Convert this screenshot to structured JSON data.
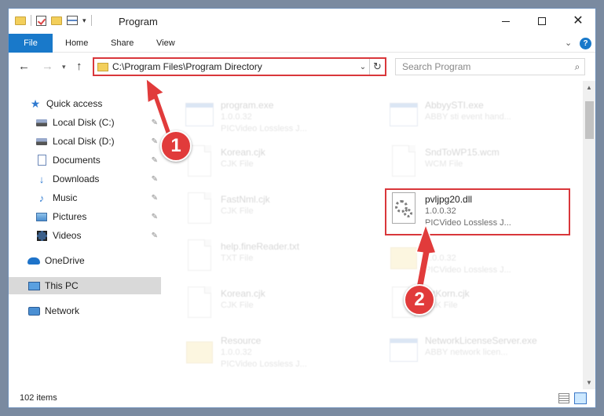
{
  "window": {
    "title": "Program"
  },
  "ribbon": {
    "tabs": [
      "File",
      "Home",
      "Share",
      "View"
    ]
  },
  "address": {
    "path": "C:\\Program Files\\Program Directory"
  },
  "search": {
    "placeholder": "Search Program"
  },
  "nav": {
    "items": [
      {
        "label": "Quick access"
      },
      {
        "label": "Local Disk (C:)"
      },
      {
        "label": "Local Disk (D:)"
      },
      {
        "label": "Documents"
      },
      {
        "label": "Downloads"
      },
      {
        "label": "Music"
      },
      {
        "label": "Pictures"
      },
      {
        "label": "Videos"
      },
      {
        "label": "OneDrive"
      },
      {
        "label": "This PC"
      },
      {
        "label": "Network"
      }
    ]
  },
  "files": [
    {
      "name": "program.exe",
      "line1": "1.0.0.32",
      "line2": "PICVideo Lossless J...",
      "icon": "exe-icon"
    },
    {
      "name": "AbbyySTI.exe",
      "line1": "ABBY sti event hand...",
      "line2": "",
      "icon": "exe-icon"
    },
    {
      "name": "Korean.cjk",
      "line1": "CJK File",
      "line2": "",
      "icon": "blank-file-icon"
    },
    {
      "name": "SndToWP15.wcm",
      "line1": "WCM File",
      "line2": "",
      "icon": "blank-file-icon"
    },
    {
      "name": "FastNml.cjk",
      "line1": "CJK File",
      "line2": "",
      "icon": "blank-file-icon"
    },
    {
      "name": "pvljpg20.dll",
      "line1": "1.0.0.32",
      "line2": "PICVideo Lossless J...",
      "icon": "dll-gear-icon"
    },
    {
      "name": "help.fineReader.txt",
      "line1": "TXT File",
      "line2": "",
      "icon": "blank-file-icon"
    },
    {
      "name": "...",
      "line1": "1.0.0.32",
      "line2": "PICVideo Lossless J...",
      "icon": "folder-icon"
    },
    {
      "name": "Korean.cjk",
      "line1": "CJK File",
      "line2": "",
      "icon": "blank-file-icon"
    },
    {
      "name": "...tKorn.cjk",
      "line1": "CJK File",
      "line2": "",
      "icon": "blank-file-icon"
    },
    {
      "name": "Resource",
      "line1": "1.0.0.32",
      "line2": "PICVideo Lossless J...",
      "icon": "folder-icon"
    },
    {
      "name": "NetworkLicenseServer.exe",
      "line1": "ABBY network licen...",
      "line2": "",
      "icon": "exe-icon"
    }
  ],
  "status": {
    "items": "102 items"
  },
  "annotations": {
    "step1": "1",
    "step2": "2",
    "color": "#e13b3b"
  },
  "icons": {
    "back": "←",
    "forward": "→",
    "up": "↑",
    "refresh": "↻",
    "search": "⌕",
    "dropdown": "⌄",
    "pin": "📌",
    "close": "✕",
    "help": "?"
  }
}
